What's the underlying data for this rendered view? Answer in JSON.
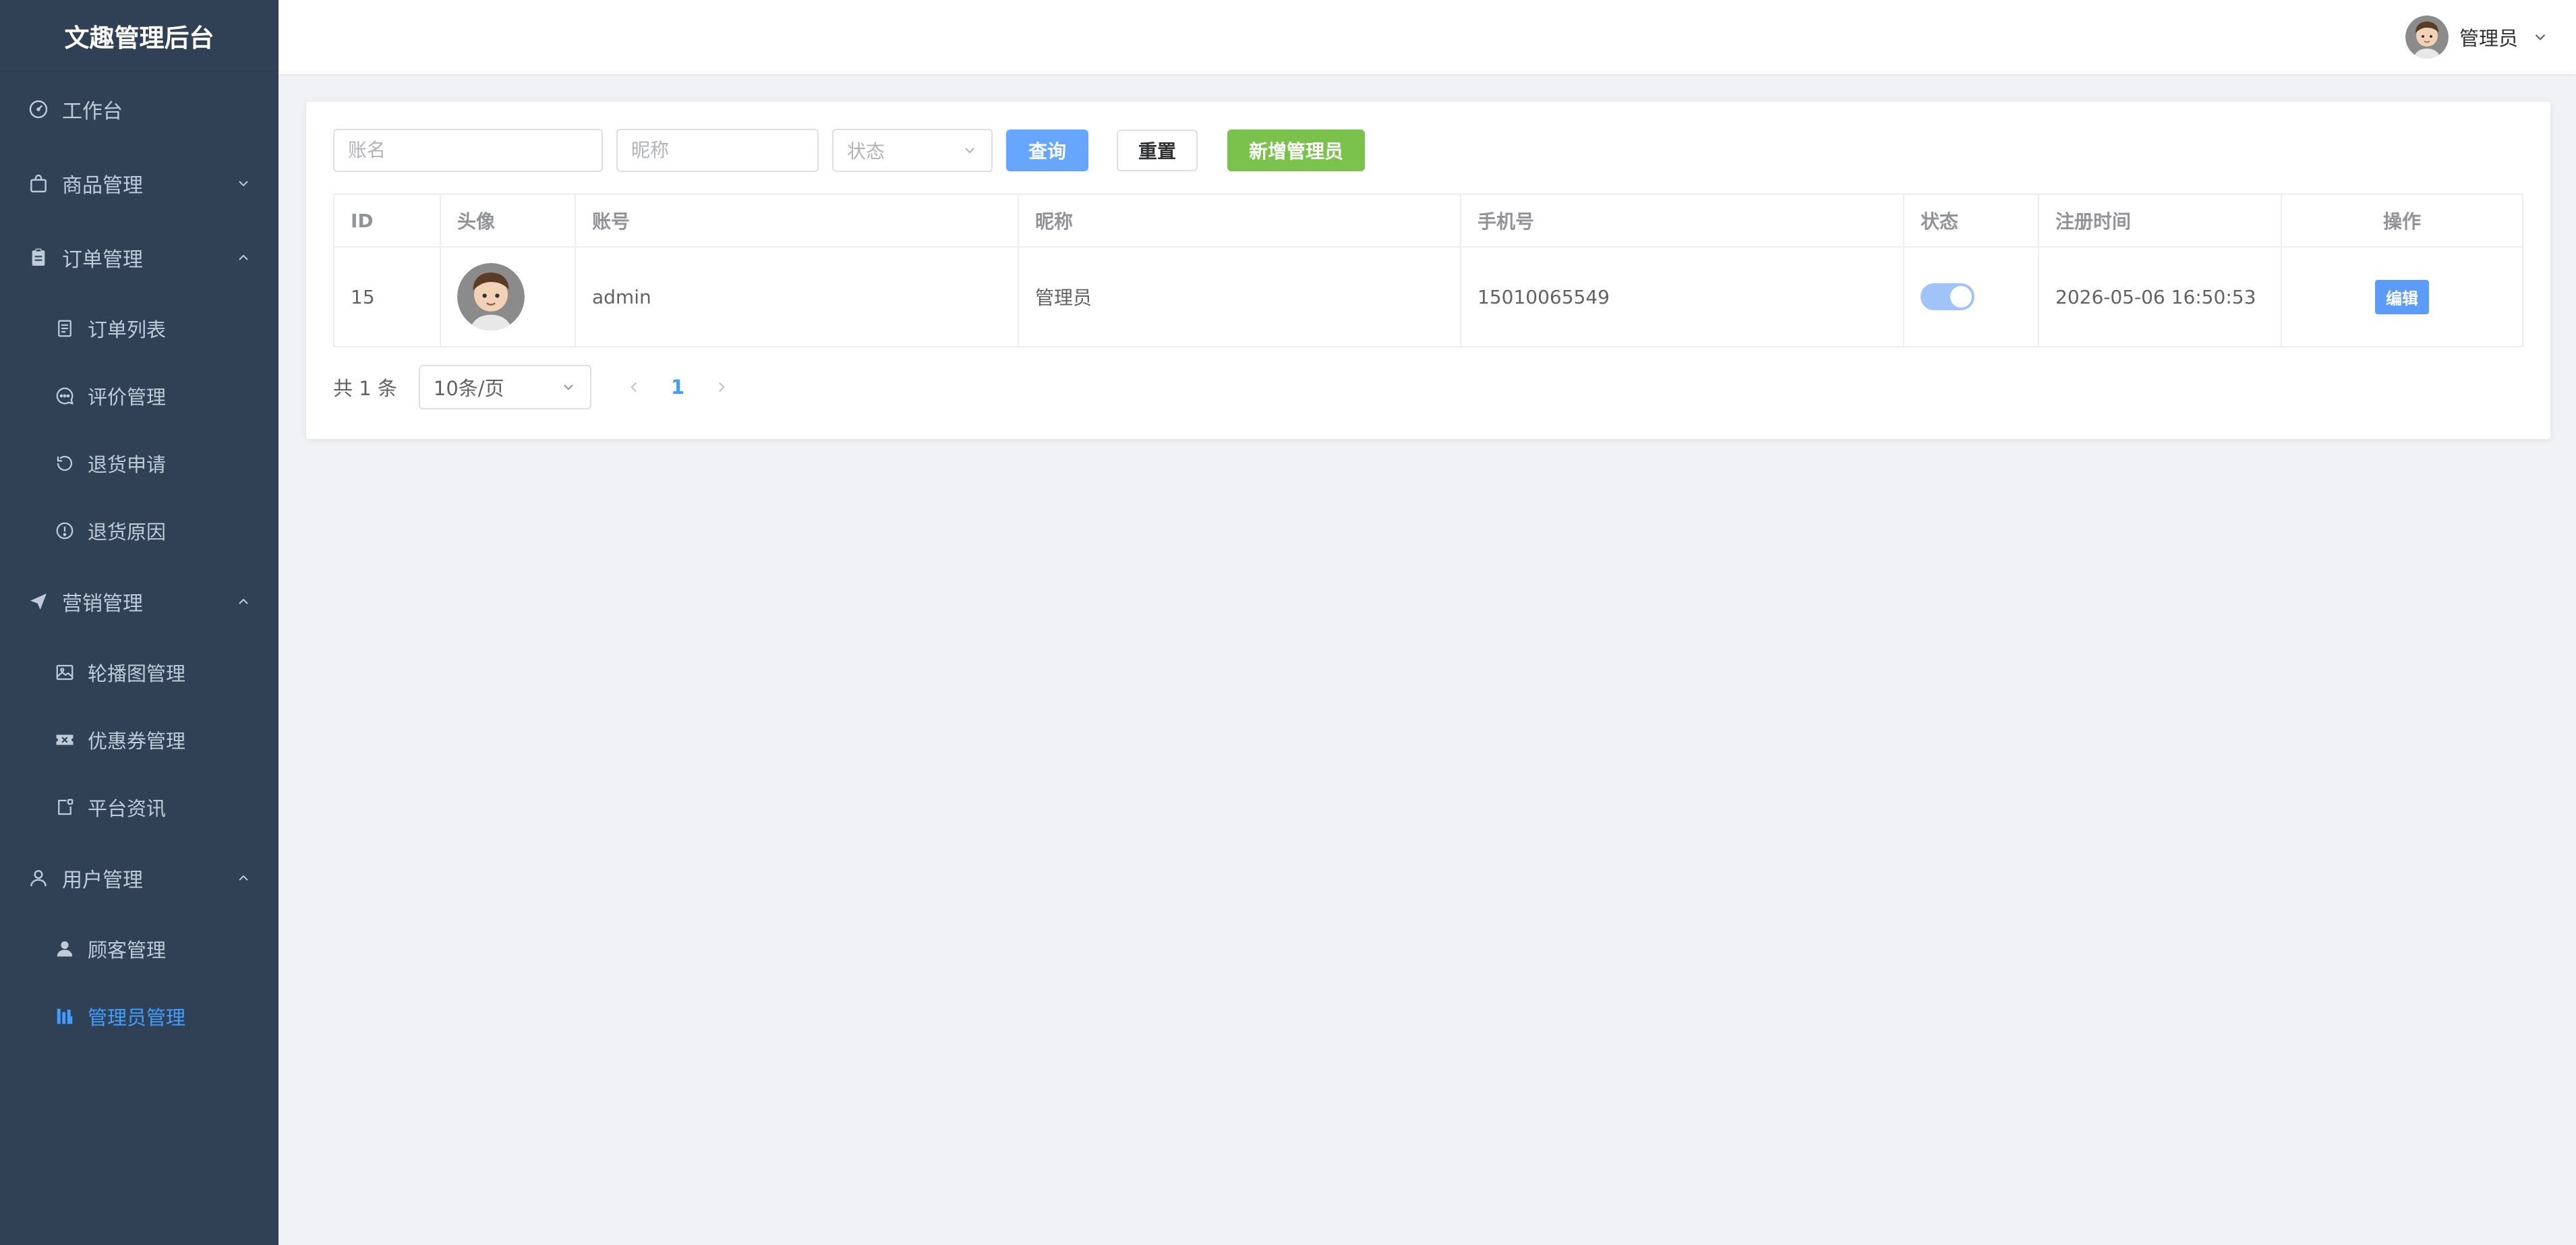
{
  "app": {
    "title": "文趣管理后台"
  },
  "sidebar": {
    "items": [
      {
        "label": "工作台",
        "icon": "dashboard-icon"
      },
      {
        "label": "商品管理",
        "icon": "bag-icon",
        "expanded": false
      },
      {
        "label": "订单管理",
        "icon": "clipboard-icon",
        "expanded": true,
        "children": [
          {
            "label": "订单列表",
            "icon": "document-icon"
          },
          {
            "label": "评价管理",
            "icon": "chat-icon"
          },
          {
            "label": "退货申请",
            "icon": "refresh-icon"
          },
          {
            "label": "退货原因",
            "icon": "warning-icon"
          }
        ]
      },
      {
        "label": "营销管理",
        "icon": "send-icon",
        "expanded": true,
        "children": [
          {
            "label": "轮播图管理",
            "icon": "picture-icon"
          },
          {
            "label": "优惠券管理",
            "icon": "ticket-icon"
          },
          {
            "label": "平台资讯",
            "icon": "news-icon"
          }
        ]
      },
      {
        "label": "用户管理",
        "icon": "user-icon",
        "expanded": true,
        "children": [
          {
            "label": "顾客管理",
            "icon": "person-icon"
          },
          {
            "label": "管理员管理",
            "icon": "admin-icon",
            "active": true
          }
        ]
      }
    ]
  },
  "header": {
    "user_name": "管理员"
  },
  "filters": {
    "account_placeholder": "账名",
    "nickname_placeholder": "昵称",
    "status_placeholder": "状态",
    "query_label": "查询",
    "reset_label": "重置",
    "add_label": "新增管理员"
  },
  "table": {
    "columns": [
      "ID",
      "头像",
      "账号",
      "昵称",
      "手机号",
      "状态",
      "注册时间",
      "操作"
    ],
    "rows": [
      {
        "id": "15",
        "account": "admin",
        "nickname": "管理员",
        "phone": "15010065549",
        "status_on": true,
        "registered": "2026-05-06 16:50:53",
        "action": "编辑"
      }
    ]
  },
  "pagination": {
    "total_text": "共 1 条",
    "page_size": "10条/页",
    "current_page": "1"
  },
  "colors": {
    "sidebar_bg": "#304156",
    "accent": "#409eff",
    "success": "#7bc24c",
    "page_bg": "#f0f2f5"
  }
}
